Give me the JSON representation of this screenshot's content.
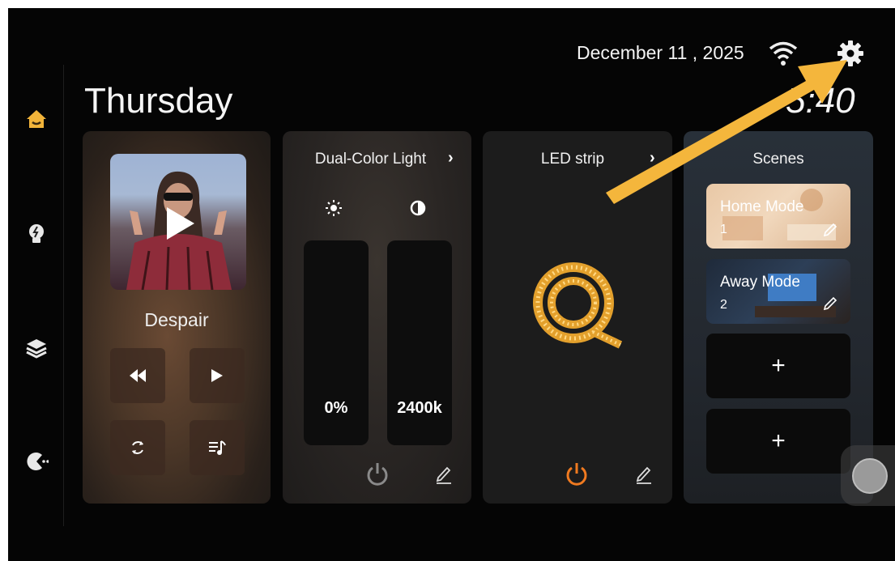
{
  "header": {
    "date": "December 11 , 2025",
    "day": "Thursday",
    "time": "5:40"
  },
  "sidebar": {
    "items": [
      {
        "icon": "home-icon",
        "active": true
      },
      {
        "icon": "bulb-icon",
        "active": false
      },
      {
        "icon": "layers-icon",
        "active": false
      },
      {
        "icon": "game-icon",
        "active": false
      }
    ]
  },
  "music": {
    "song": "Despair",
    "buttons": [
      "rewind-icon",
      "forward-icon",
      "repeat-icon",
      "playlist-icon"
    ]
  },
  "dual_light": {
    "title": "Dual-Color Light",
    "brightness": "0%",
    "color_temp": "2400k"
  },
  "led_strip": {
    "title": "LED strip",
    "power_on": true
  },
  "scenes": {
    "title": "Scenes",
    "items": [
      {
        "name": "Home Mode",
        "number": "1"
      },
      {
        "name": "Away Mode",
        "number": "2"
      }
    ],
    "add_label": "+"
  },
  "colors": {
    "accent_orange": "#f07a20",
    "arrow_yellow": "#f4b63c",
    "home_icon": "#f2b43a"
  }
}
